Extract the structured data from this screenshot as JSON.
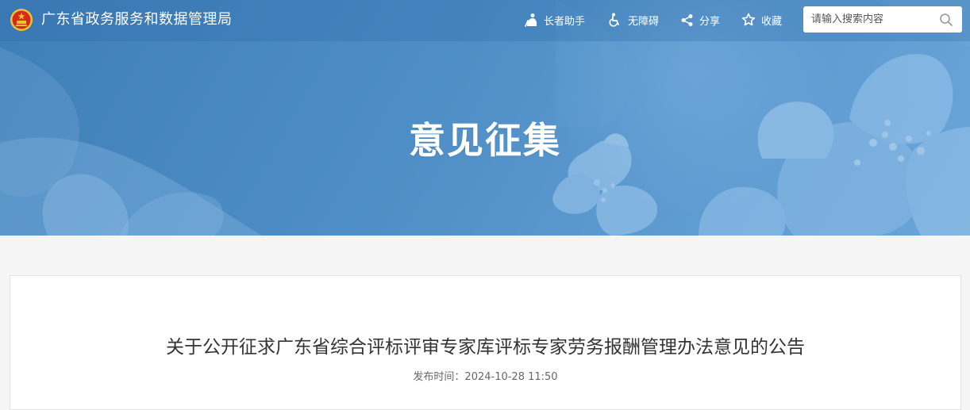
{
  "header": {
    "site_title": "广东省政务服务和数据管理局",
    "tools": {
      "elder": "长者助手",
      "accessibility": "无障碍",
      "share": "分享",
      "favorite": "收藏"
    },
    "search": {
      "placeholder": "请输入搜索内容",
      "value": ""
    }
  },
  "banner": {
    "title": "意见征集"
  },
  "article": {
    "title": "关于公开征求广东省综合评标评审专家库评标专家劳务报酬管理办法意见的公告",
    "meta_label": "发布时间：",
    "publish_time": "2024-10-28 11:50"
  },
  "colors": {
    "banner": "#4f8ec6",
    "text_dark": "#333333",
    "text_meta": "#666666",
    "emblem_red": "#d62a1d",
    "emblem_gold": "#f2c230"
  },
  "icons": [
    "emblem-icon",
    "elder-icon",
    "accessibility-icon",
    "share-icon",
    "star-icon",
    "search-icon"
  ]
}
